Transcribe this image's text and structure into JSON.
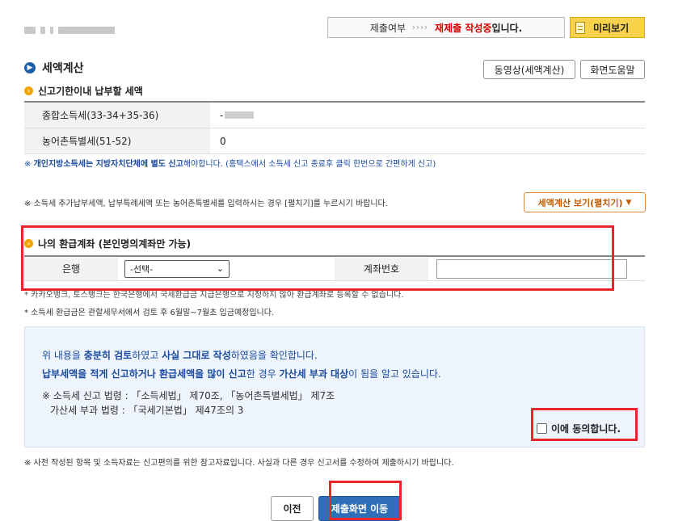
{
  "header": {
    "status_label": "제출여부",
    "status_arrows": "››››",
    "status_value": "재제출 작성중",
    "status_suffix": "입니다.",
    "preview_label": "미리보기"
  },
  "section": {
    "title": "세액계산",
    "video_button": "동영상(세액계산)",
    "help_button": "화면도움말",
    "subtitle": "신고기한이내 납부할 세액"
  },
  "tax_rows": [
    {
      "label": "종합소득세(33-34+35-36)",
      "value": "-"
    },
    {
      "label": "농어촌특별세(51-52)",
      "value": "0"
    }
  ],
  "notes": {
    "local_tax_prefix": "※ ",
    "local_tax_bold": "개인지방소득세는 지방자치단체에 별도 신고",
    "local_tax_rest": "해야합니다. (홈택스에서 소득세 신고 종료후 클릭 한번으로 간편하게 신고)",
    "extra_payment": "※ 소득세 추가납부세액, 납부특례세액 또는 농어촌특별세를 입력하시는 경우 [펼치기]를 누르시기 바랍니다.",
    "expand_button": "세액계산 보기(펼치기)",
    "kakao_notice": "* 카카오뱅크, 토스뱅크는 한국은행에서 국세환급금 지급은행으로 지정하지 않아 환급계좌로 등록할 수 없습니다.",
    "refund_date": "* 소득세 환급금은 관할세무서에서 검토 후 6월말~7월초 입금예정입니다.",
    "reference": "※ 사전 작성된 항목 및 소득자료는 신고편의를 위한 참고자료입니다. 사실과 다른 경우 신고서를 수정하여 제출하시기 바랍니다."
  },
  "refund": {
    "title": "나의 환급계좌 (본인명의계좌만 가능)",
    "bank_label": "은행",
    "bank_selected": "-선택-",
    "account_label": "계좌번호",
    "account_value": ""
  },
  "agreement": {
    "l1_a": "위 내용을 ",
    "l1_b": "충분히 검토",
    "l1_c": "하였고 ",
    "l1_d": "사실 그대로 작성",
    "l1_e": "하였음을 확인합니다.",
    "l2_a": "납부세액을 적게 신고하거나 환급세액을 많이 신고",
    "l2_b": "한 경우 ",
    "l2_c": "가산세 부과 대상",
    "l2_d": "이 됨을 알고 있습니다.",
    "law1": "※ 소득세 신고 법령 : 「소득세법」 제70조, 「농어촌특별세법」 제7조",
    "law2": "가산세 부과 법령 : 「국세기본법」 제47조의 3",
    "checkbox_label": "이에 동의합니다."
  },
  "buttons": {
    "prev": "이전",
    "submit": "제출화면 이동"
  },
  "colors": {
    "accent_blue": "#1c5ea8",
    "highlight_red": "#d40000",
    "annotation_red": "#e8262c",
    "preview_yellow": "#f7d24a"
  }
}
